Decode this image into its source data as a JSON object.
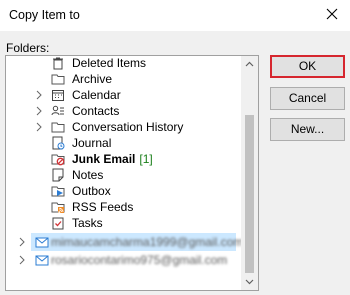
{
  "window": {
    "title": "Copy Item to"
  },
  "labels": {
    "folders": "Folders:"
  },
  "buttons": {
    "ok": "OK",
    "cancel": "Cancel",
    "new": "New..."
  },
  "tree": {
    "deleted_items": "Deleted Items",
    "archive": "Archive",
    "calendar": "Calendar",
    "contacts": "Contacts",
    "conversation_history": "Conversation History",
    "journal": "Journal",
    "junk_email": "Junk Email",
    "junk_email_count": "[1]",
    "notes": "Notes",
    "outbox": "Outbox",
    "rss_feeds": "RSS Feeds",
    "tasks": "Tasks",
    "account1": "mimaucamcharma1999@gmail.com",
    "account2": "rosariocontarimo975@gmail.com"
  },
  "colors": {
    "selection": "#cce8ff",
    "ok_border": "#d6262e",
    "count_green": "#1a7f1a"
  }
}
